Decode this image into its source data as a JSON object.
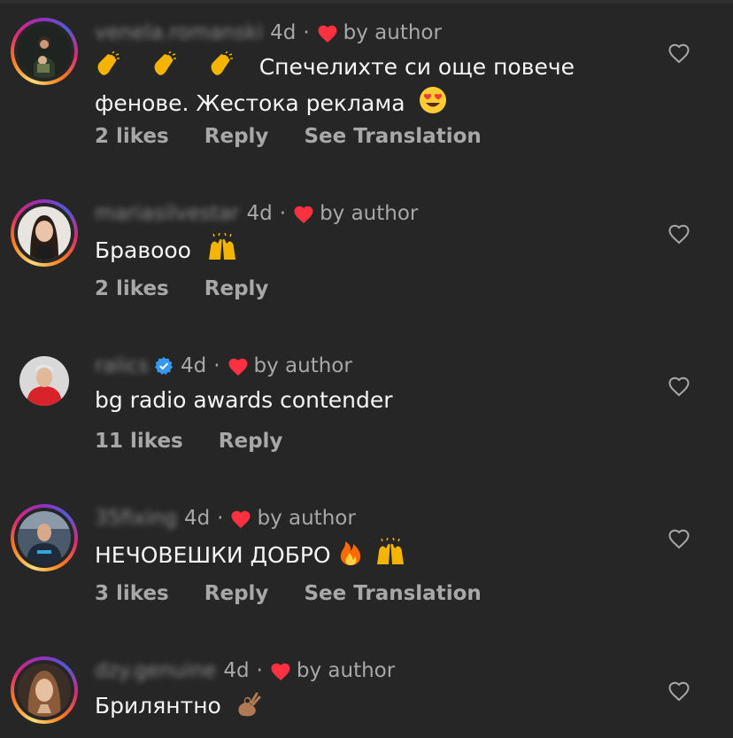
{
  "comments": [
    {
      "username": "venela.romanski",
      "time": "4d",
      "author_label": "by author",
      "text_line1": "Спечелихте си още повече",
      "text_line2": "фенове. Жестока реклама",
      "likes": "2 likes",
      "reply": "Reply",
      "translate": "See Translation"
    },
    {
      "username": "mariasilvestar",
      "time": "4d",
      "author_label": "by author",
      "text": "Бравооо",
      "likes": "2 likes",
      "reply": "Reply"
    },
    {
      "username": "ralics",
      "time": "4d",
      "author_label": "by author",
      "text": "bg radio awards contender",
      "likes": "11 likes",
      "reply": "Reply"
    },
    {
      "username": "35fixing",
      "time": "4d",
      "author_label": "by author",
      "text": "НЕЧОВЕШКИ ДОБРО",
      "likes": "3 likes",
      "reply": "Reply",
      "translate": "See Translation"
    },
    {
      "username": "dzy.genuine",
      "time": "4d",
      "author_label": "by author",
      "text": "Брилянтно"
    }
  ],
  "colors": {
    "background": "#262626",
    "muted_text": "#a8a8a8",
    "primary_text": "#f5f5f5",
    "heart_red": "#ff3040",
    "verified_blue": "#3897f0"
  }
}
